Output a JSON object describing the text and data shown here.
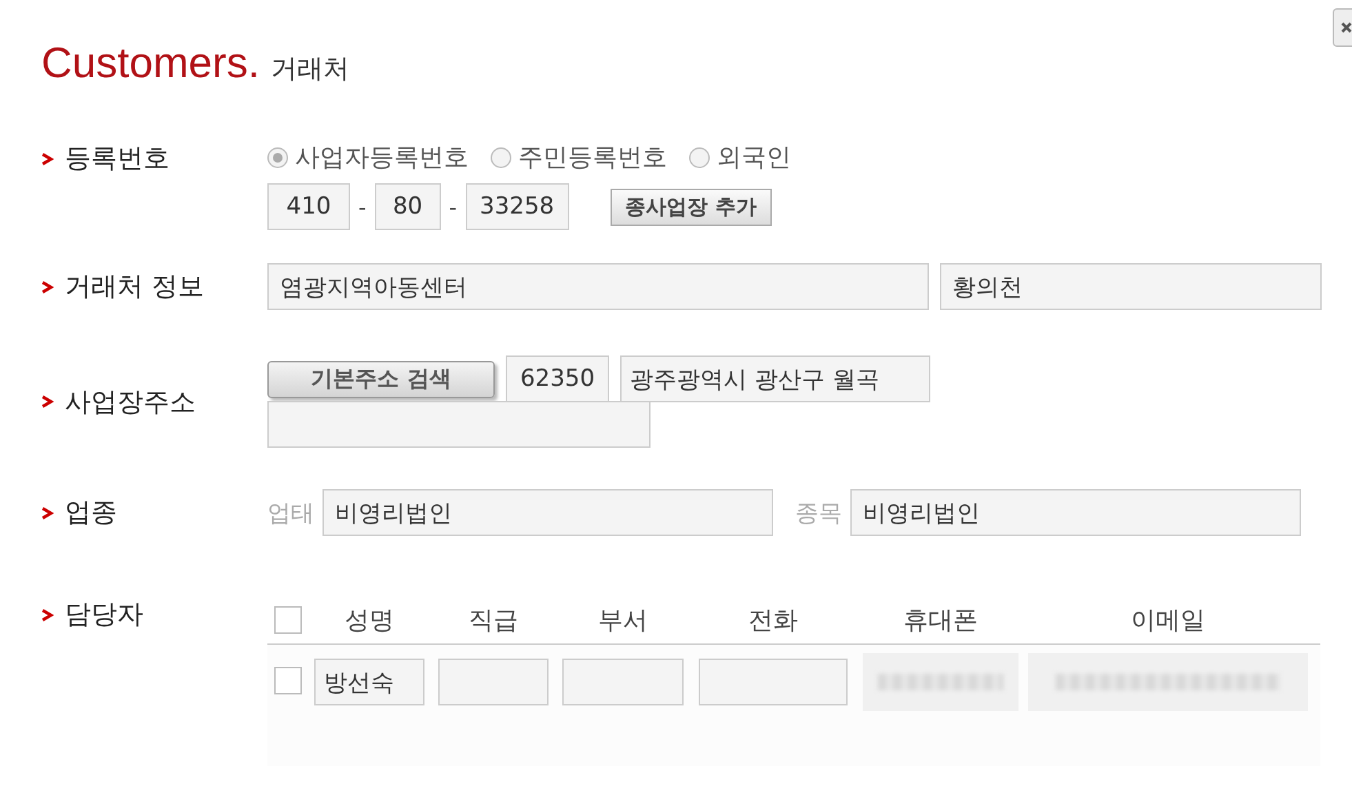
{
  "title": {
    "main": "Customers.",
    "sub": "거래처"
  },
  "registration": {
    "label": "등록번호",
    "options": [
      {
        "label": "사업자등록번호",
        "selected": true
      },
      {
        "label": "주민등록번호",
        "selected": false
      },
      {
        "label": "외국인",
        "selected": false
      }
    ],
    "number": [
      "410",
      "80",
      "33258"
    ],
    "separator": "-",
    "add_button": "종사업장 추가"
  },
  "customer_info": {
    "label": "거래처 정보",
    "name": "염광지역아동센터",
    "representative": "황의천"
  },
  "address": {
    "label": "사업장주소",
    "search_button": "기본주소 검색",
    "postal_code": "62350",
    "address_line": "광주광역시 광산구 월곡"
  },
  "business": {
    "label": "업종",
    "type_label": "업태",
    "type": "비영리법인",
    "item_label": "종목",
    "item": "비영리법인"
  },
  "contacts": {
    "label": "담당자",
    "all_checked": false,
    "columns": [
      "성명",
      "직급",
      "부서",
      "전화",
      "휴대폰",
      "이메일"
    ],
    "rows": [
      {
        "checked": false,
        "cells": [
          {
            "kind": "field",
            "value": "방선숙"
          },
          {
            "kind": "field"
          },
          {
            "kind": "field"
          },
          {
            "kind": "field"
          },
          {
            "kind": "blurred"
          },
          {
            "kind": "blurred"
          }
        ]
      }
    ]
  }
}
